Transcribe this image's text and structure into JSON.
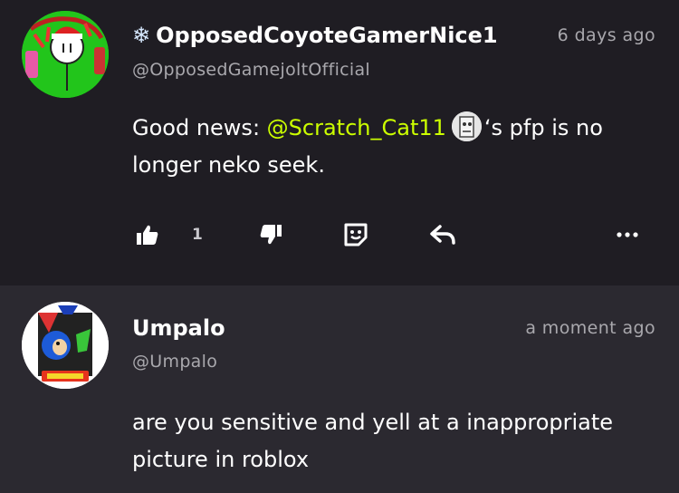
{
  "posts": [
    {
      "display_name": "OpposedCoyoteGamerNice1",
      "name_prefix_icon": "snowflake-icon",
      "handle": "@OpposedGamejoltOfficial",
      "time": "6 days ago",
      "body_before": "Good news: ",
      "mention": "@Scratch_Cat11",
      "body_after": "‘s pfp is no longer neko seek.",
      "like_count": "1"
    },
    {
      "display_name": "Umpalo",
      "handle": "@Umpalo",
      "time": "a moment ago",
      "body": "are you sensitive and yell at a inappropriate picture in roblox"
    }
  ],
  "colors": {
    "background": "#1f1d23",
    "second_post_background": "#2b2930",
    "mention": "#ccff00",
    "muted_text": "#a9a8ad"
  },
  "icons": [
    "thumbs-up-icon",
    "thumbs-down-icon",
    "sticker-icon",
    "reply-icon",
    "more-icon"
  ]
}
